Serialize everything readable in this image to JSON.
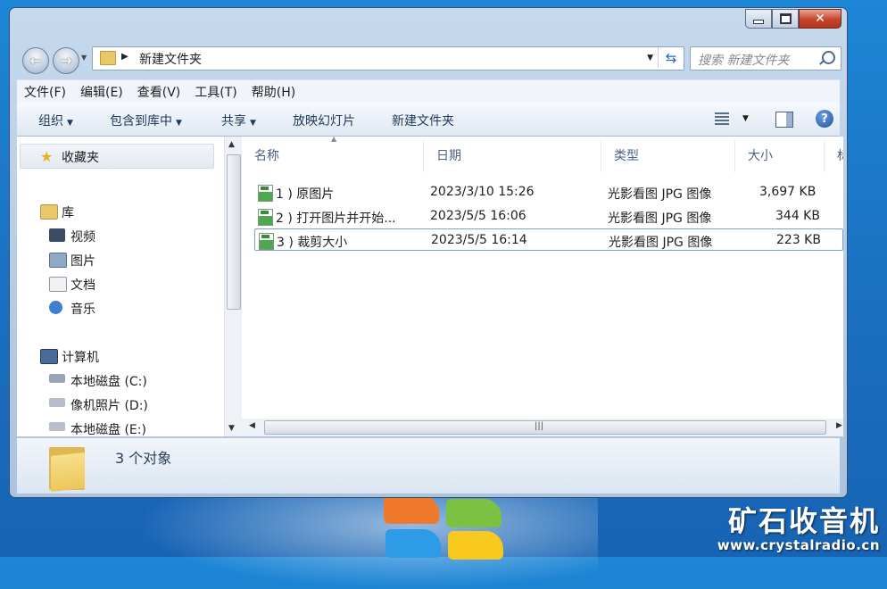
{
  "window": {
    "caption_buttons": [
      "minimize",
      "maximize",
      "close"
    ]
  },
  "address": {
    "path": "新建文件夹",
    "search_placeholder": "搜索 新建文件夹"
  },
  "menu": [
    "文件(F)",
    "编辑(E)",
    "查看(V)",
    "工具(T)",
    "帮助(H)"
  ],
  "toolbar": {
    "organize": "组织",
    "include_library": "包含到库中",
    "share": "共享",
    "slideshow": "放映幻灯片",
    "new_folder": "新建文件夹"
  },
  "nav": {
    "favorites": "收藏夹",
    "libraries": "库",
    "videos": "视频",
    "pictures": "图片",
    "documents": "文档",
    "music": "音乐",
    "computer": "计算机",
    "drive_c": "本地磁盘 (C:)",
    "drive_d": "像机照片 (D:)",
    "drive_e": "本地磁盘 (E:)"
  },
  "columns": {
    "name": "名称",
    "date": "日期",
    "type": "类型",
    "size": "大小",
    "tags": "标记"
  },
  "files": [
    {
      "name": "1 ) 原图片",
      "date": "2023/3/10 15:26",
      "type": "光影看图 JPG 图像",
      "size": "3,697 KB"
    },
    {
      "name": "2 ) 打开图片并开始...",
      "date": "2023/5/5 16:06",
      "type": "光影看图 JPG 图像",
      "size": "344 KB"
    },
    {
      "name": "3 ) 裁剪大小",
      "date": "2023/5/5 16:14",
      "type": "光影看图 JPG 图像",
      "size": "223 KB"
    }
  ],
  "details": {
    "count": "3 个对象"
  },
  "watermark": {
    "title": "矿石收音机",
    "url": "www.crystalradio.cn"
  },
  "colors": {
    "desktop": "#1b6fc0",
    "selection_border": "#7da2ce",
    "close_button": "#c4442c"
  }
}
